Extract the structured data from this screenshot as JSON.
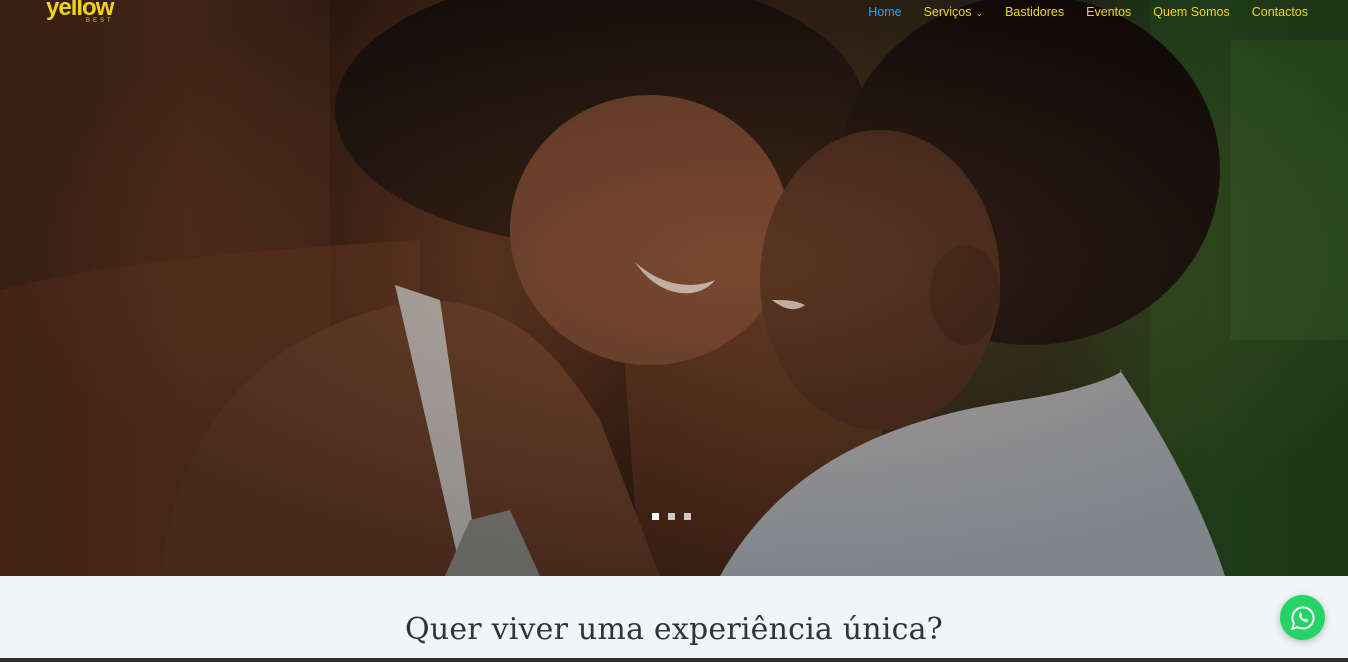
{
  "logo": {
    "text": "yellow",
    "subtext": "BEST"
  },
  "nav": {
    "items": [
      {
        "label": "Home",
        "active": true
      },
      {
        "label": "Serviços",
        "has_dropdown": true
      },
      {
        "label": "Bastidores"
      },
      {
        "label": "Eventos"
      },
      {
        "label": "Quem Somos"
      },
      {
        "label": "Contactos"
      }
    ]
  },
  "hero": {
    "slide_count": 3,
    "active_slide": 1
  },
  "section": {
    "headline": "Quer viver uma experiência única?"
  },
  "floating": {
    "icon": "whatsapp-icon"
  },
  "colors": {
    "accent": "#f4d21c",
    "active": "#2ea3f2",
    "whatsapp": "#25d366"
  }
}
